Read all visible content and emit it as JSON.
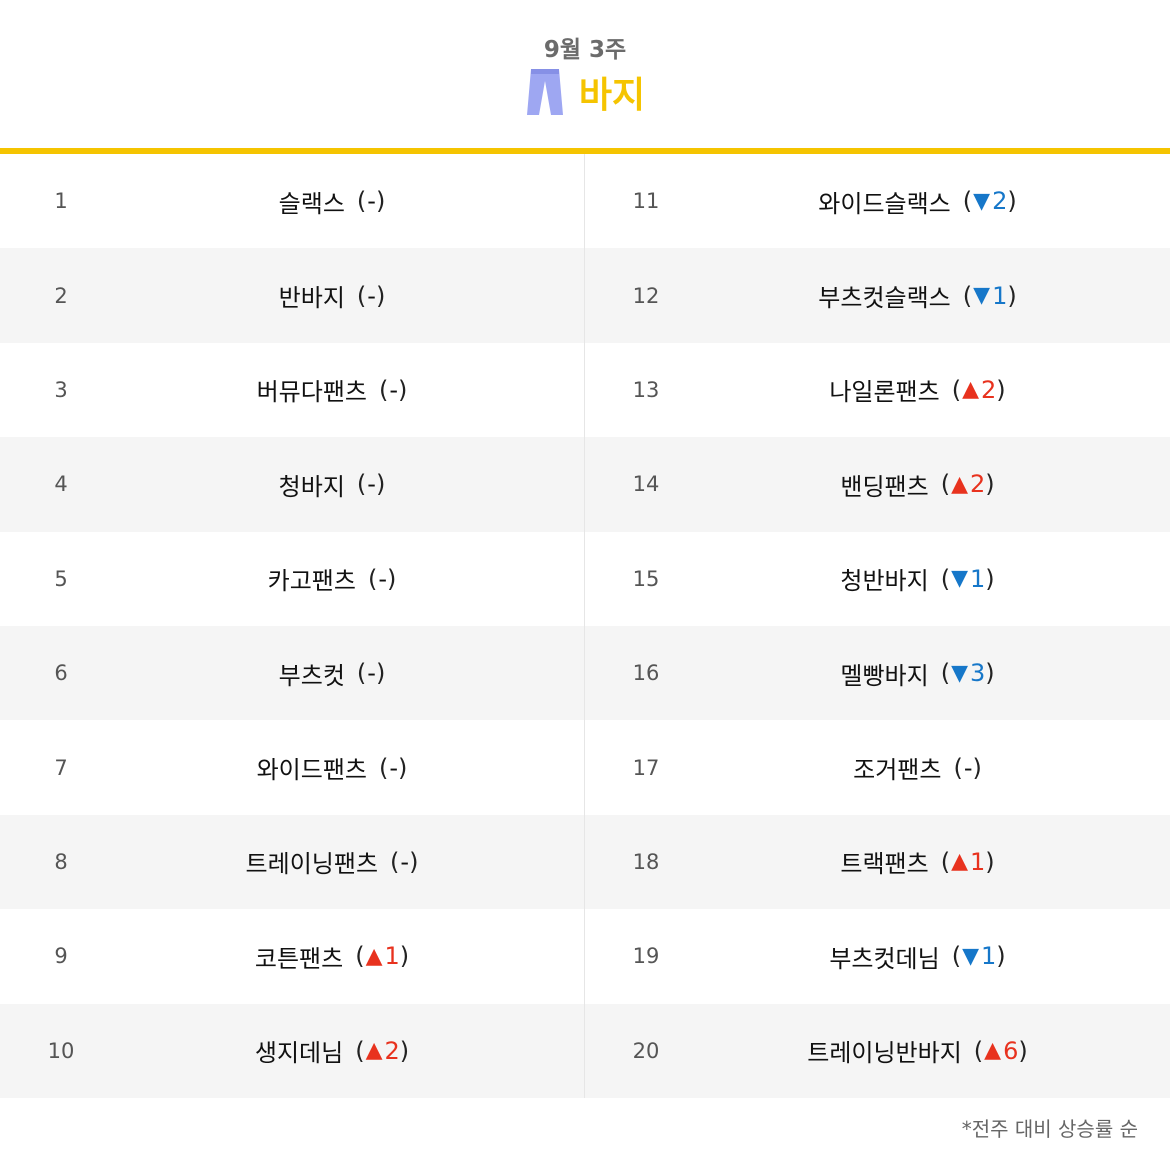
{
  "header": {
    "week_label": "9월 3주",
    "category_title": "바지",
    "icon": "pants-icon"
  },
  "colors": {
    "accent": "#f5c400",
    "up": "#e8321e",
    "down": "#1677c9",
    "icon": "#9ea7f2",
    "row_shade": "#f5f5f5"
  },
  "rankings": [
    {
      "rank": "1",
      "name": "슬랙스",
      "trend": "same",
      "change": "-"
    },
    {
      "rank": "2",
      "name": "반바지",
      "trend": "same",
      "change": "-"
    },
    {
      "rank": "3",
      "name": "버뮤다팬츠",
      "trend": "same",
      "change": "-"
    },
    {
      "rank": "4",
      "name": "청바지",
      "trend": "same",
      "change": "-"
    },
    {
      "rank": "5",
      "name": "카고팬츠",
      "trend": "same",
      "change": "-"
    },
    {
      "rank": "6",
      "name": "부츠컷",
      "trend": "same",
      "change": "-"
    },
    {
      "rank": "7",
      "name": "와이드팬츠",
      "trend": "same",
      "change": "-"
    },
    {
      "rank": "8",
      "name": "트레이닝팬츠",
      "trend": "same",
      "change": "-"
    },
    {
      "rank": "9",
      "name": "코튼팬츠",
      "trend": "up",
      "change": "1"
    },
    {
      "rank": "10",
      "name": "생지데님",
      "trend": "up",
      "change": "2"
    },
    {
      "rank": "11",
      "name": "와이드슬랙스",
      "trend": "down",
      "change": "2"
    },
    {
      "rank": "12",
      "name": "부츠컷슬랙스",
      "trend": "down",
      "change": "1"
    },
    {
      "rank": "13",
      "name": "나일론팬츠",
      "trend": "up",
      "change": "2"
    },
    {
      "rank": "14",
      "name": "밴딩팬츠",
      "trend": "up",
      "change": "2"
    },
    {
      "rank": "15",
      "name": "청반바지",
      "trend": "down",
      "change": "1"
    },
    {
      "rank": "16",
      "name": "멜빵바지",
      "trend": "down",
      "change": "3"
    },
    {
      "rank": "17",
      "name": "조거팬츠",
      "trend": "same",
      "change": "-"
    },
    {
      "rank": "18",
      "name": "트랙팬츠",
      "trend": "up",
      "change": "1"
    },
    {
      "rank": "19",
      "name": "부츠컷데님",
      "trend": "down",
      "change": "1"
    },
    {
      "rank": "20",
      "name": "트레이닝반바지",
      "trend": "up",
      "change": "6"
    }
  ],
  "footnote": "*전주 대비 상승률 순"
}
